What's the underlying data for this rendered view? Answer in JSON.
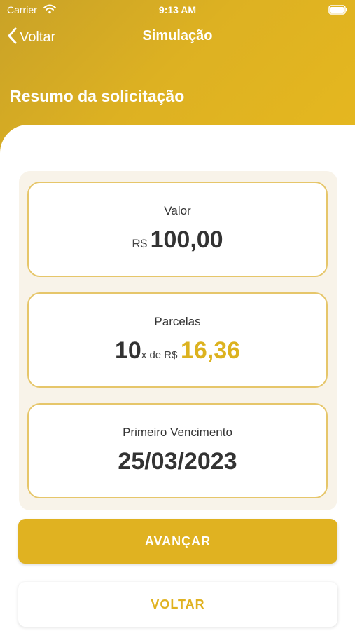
{
  "status": {
    "carrier": "Carrier",
    "time": "9:13 AM"
  },
  "nav": {
    "back_label": "Voltar",
    "title": "Simulação"
  },
  "heading": "Resumo da solicitação",
  "cards": {
    "valor": {
      "label": "Valor",
      "currency": "R$",
      "amount": "100,00"
    },
    "parcelas": {
      "label": "Parcelas",
      "count": "10",
      "connector": "x de R$",
      "amount": "16,36"
    },
    "vencimento": {
      "label": "Primeiro Vencimento",
      "date": "25/03/2023"
    }
  },
  "buttons": {
    "primary": "AVANÇAR",
    "secondary": "VOLTAR"
  },
  "colors": {
    "accent": "#dcb21f",
    "card_border": "#e6c66a",
    "panel_bg": "#f8f3e9",
    "text": "#333333"
  }
}
